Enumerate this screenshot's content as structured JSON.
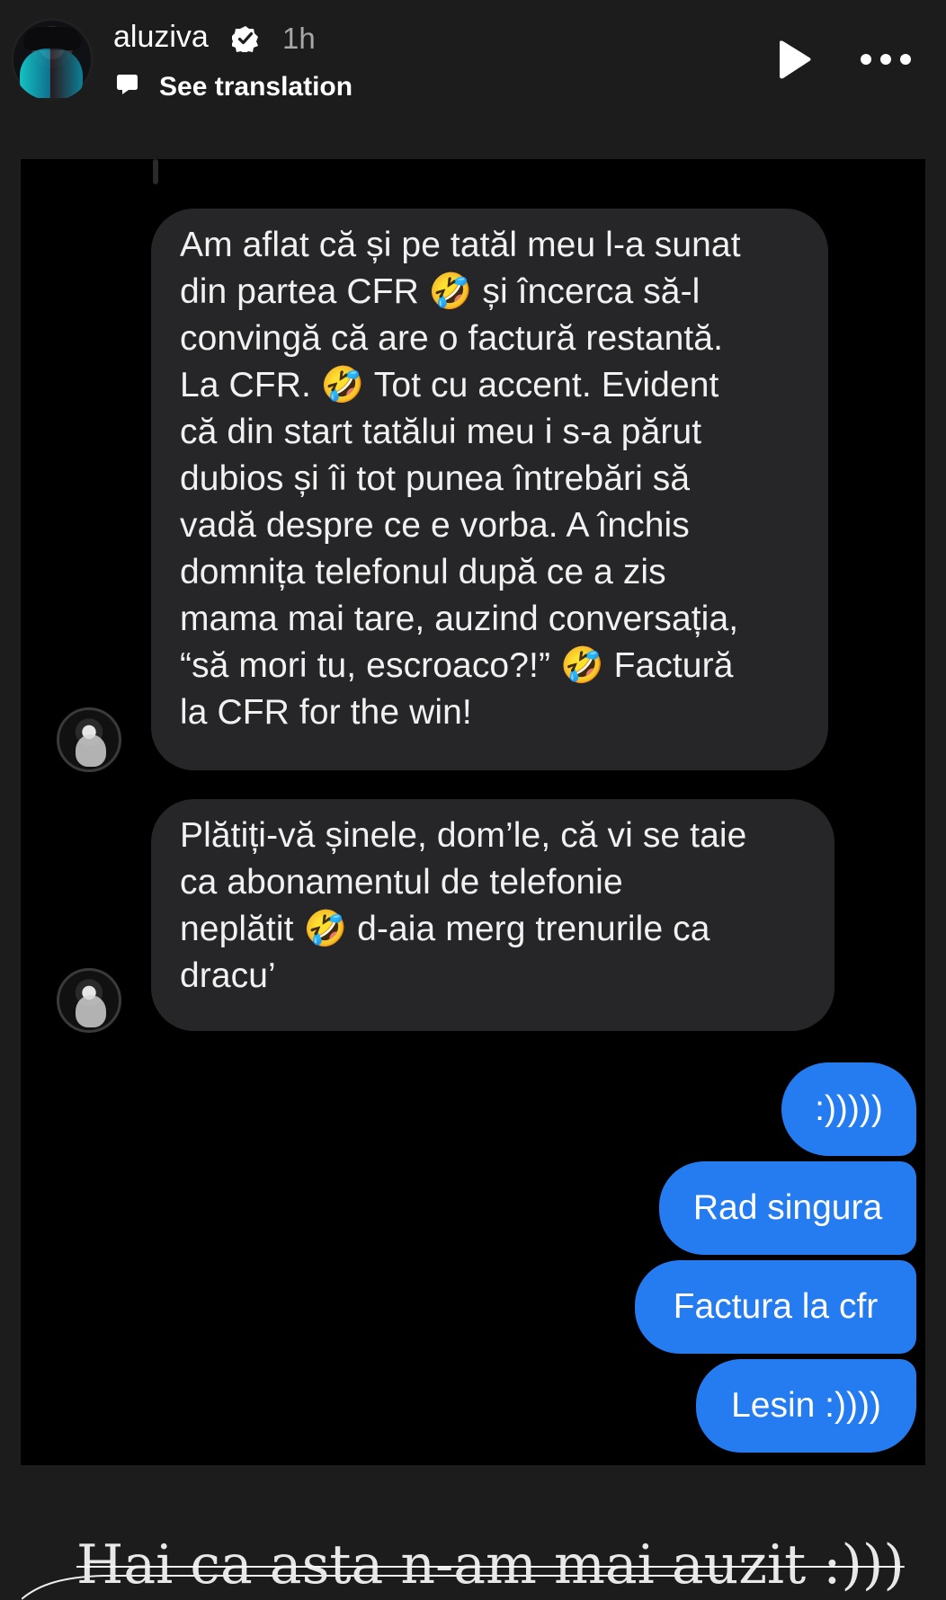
{
  "header": {
    "username": "aluziva",
    "time": "1h",
    "translation_label": "See translation",
    "icons": {
      "verified": "verified-badge-icon",
      "translate": "translate-bubble-icon",
      "play": "play-icon",
      "more": "more-options-icon"
    }
  },
  "messages": {
    "incoming": [
      {
        "text": "Am aflat că și pe tatăl meu l-a sunat\ndin partea CFR 🤣 și încerca să-l\nconvingă că are o factură restantă.\nLa CFR. 🤣 Tot cu accent. Evident\ncă din start tatălui meu i s-a părut\ndubios și îi tot punea întrebări să\nvadă despre ce e vorba. A închis\ndomnița telefonul după ce a zis\nmama mai tare, auzind conversația,\n“să mori tu, escroaco?!” 🤣 Factură\nla CFR for the win!"
      },
      {
        "text": "Plătiți-vă șinele, dom’le, că vi se taie\nca abonamentul de telefonie\nneplătit 🤣 d-aia merg trenurile ca\ndracu’"
      }
    ],
    "outgoing": [
      ":)))))",
      "Rad singura",
      "Factura la cfr",
      "Lesin :))))"
    ]
  },
  "caption": "Hai ca asta n-am mai auzit :)))",
  "colors": {
    "background": "#1c1c1c",
    "chat_background": "#000000",
    "incoming_bubble": "#262629",
    "outgoing_bubble": "#247cf0",
    "text": "#f2f2f2"
  }
}
